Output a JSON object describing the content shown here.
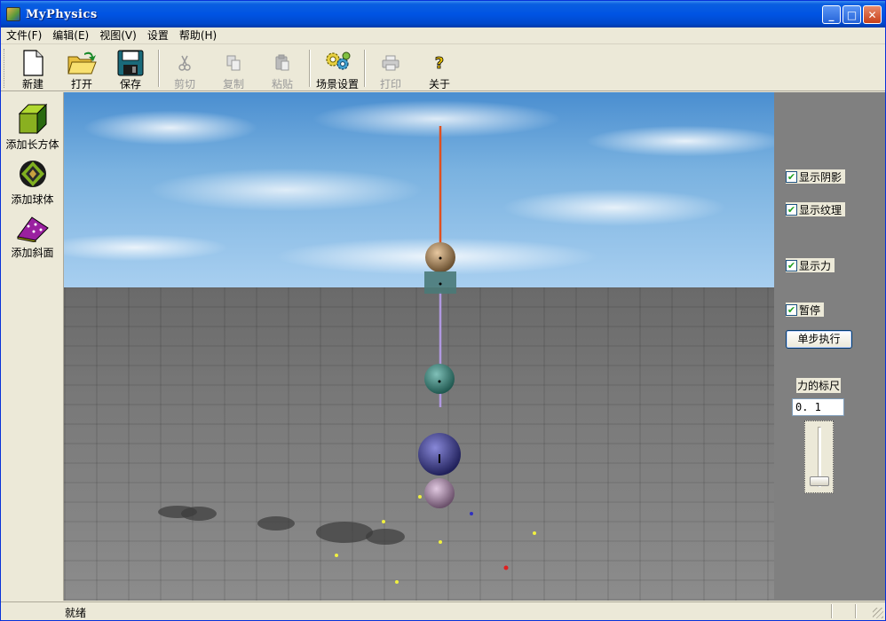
{
  "window": {
    "title": "MyPhysics"
  },
  "menu": [
    "文件(F)",
    "编辑(E)",
    "视图(V)",
    "设置",
    "帮助(H)"
  ],
  "toolbar": {
    "new": "新建",
    "open": "打开",
    "save": "保存",
    "cut": "剪切",
    "copy": "复制",
    "paste": "粘贴",
    "scene_settings": "场景设置",
    "print": "打印",
    "about": "关于"
  },
  "sidebar": {
    "add_box": "添加长方体",
    "add_sphere": "添加球体",
    "add_slope": "添加斜面"
  },
  "panel": {
    "show_shadow": {
      "label": "显示阴影",
      "checked": true
    },
    "show_texture": {
      "label": "显示纹理",
      "checked": true
    },
    "show_force": {
      "label": "显示力",
      "checked": true
    },
    "pause": {
      "label": "暂停",
      "checked": true
    },
    "step_button": "单步执行",
    "force_scale_label": "力的标尺",
    "force_scale_value": "0. 1",
    "force_scale_slider_fraction": 0.0
  },
  "status": {
    "text": "就绪"
  },
  "icons": {
    "new": "new-document-icon",
    "open": "open-folder-icon",
    "save": "floppy-disk-icon",
    "cut": "scissors-icon",
    "copy": "copy-icon",
    "paste": "paste-icon",
    "scene": "gears-icon",
    "print": "printer-icon",
    "about": "question-mark-icon",
    "box": "cube-icon",
    "sphere": "sphere-icon",
    "slope": "slope-icon"
  }
}
